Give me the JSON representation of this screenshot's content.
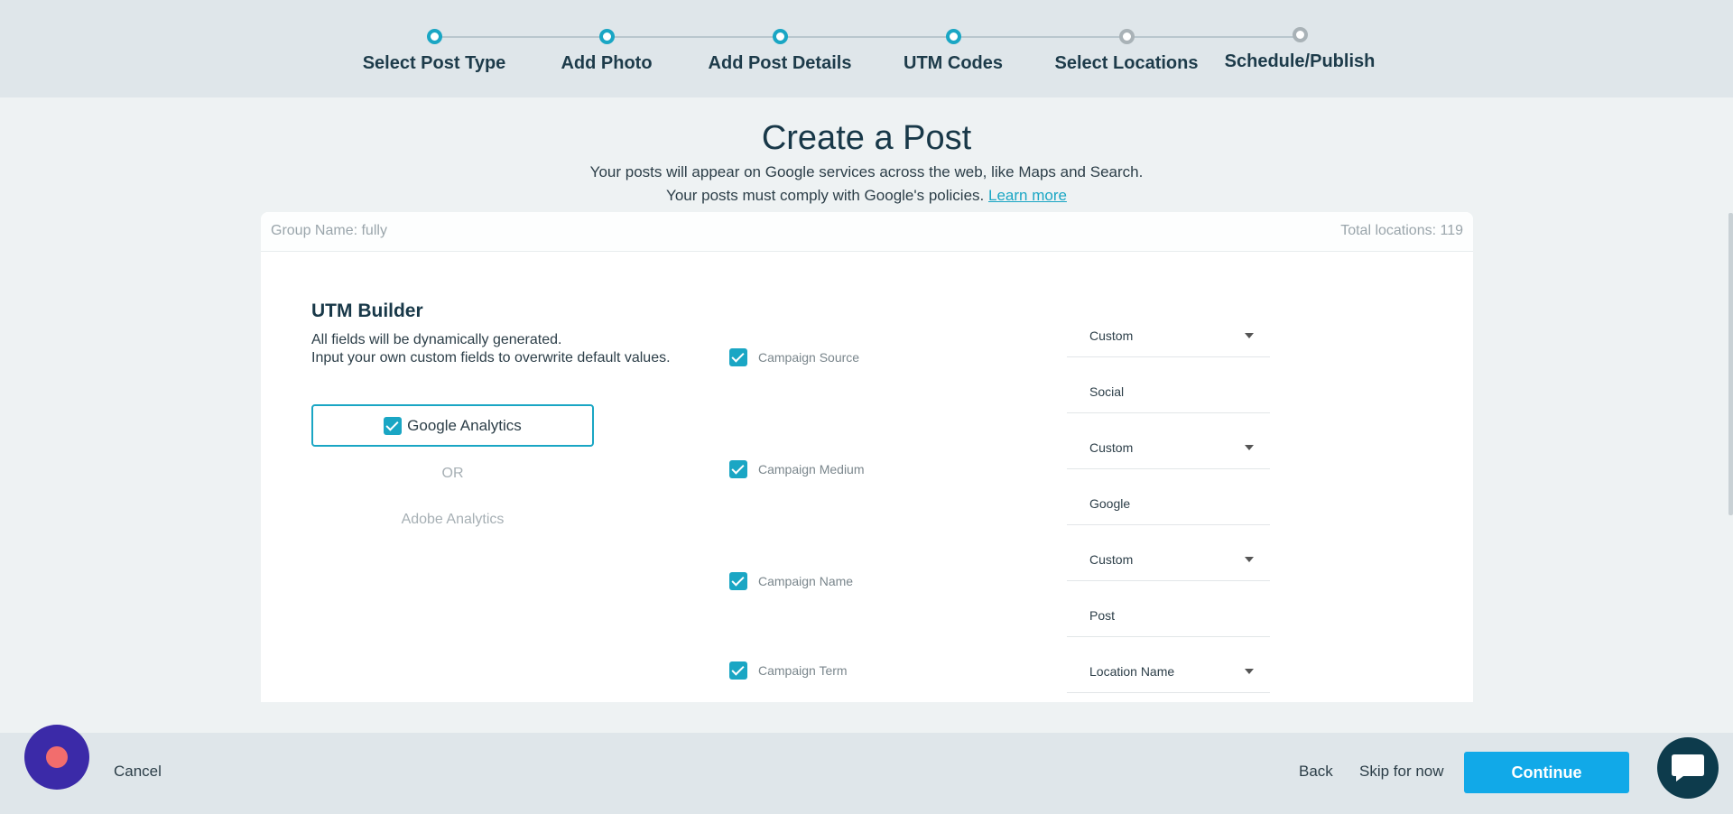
{
  "stepper": {
    "steps": [
      {
        "label": "Select Post Type",
        "state": "done"
      },
      {
        "label": "Add Photo",
        "state": "done"
      },
      {
        "label": "Add Post Details",
        "state": "done"
      },
      {
        "label": "UTM Codes",
        "state": "current"
      },
      {
        "label": "Select Locations",
        "state": "pending"
      },
      {
        "label": "Schedule/Publish",
        "state": "pending"
      }
    ]
  },
  "header": {
    "title": "Create a Post",
    "subtitle_line1": "Your posts will appear on Google services across the web, like Maps and Search.",
    "subtitle_line2": "Your posts must comply with Google's policies.",
    "learn_more": "Learn more"
  },
  "card": {
    "group_name": "Group Name: fully",
    "total_locations": "Total locations: 119"
  },
  "utm": {
    "title": "UTM Builder",
    "desc_line1": "All fields will be dynamically generated.",
    "desc_line2": "Input your own custom fields to overwrite default values.",
    "google_analytics": "Google Analytics",
    "or": "OR",
    "adobe_analytics": "Adobe Analytics"
  },
  "fields": {
    "source": {
      "label": "Campaign Source",
      "select": "Custom",
      "value": "Social"
    },
    "medium": {
      "label": "Campaign Medium",
      "select": "Custom",
      "value": "Google"
    },
    "name": {
      "label": "Campaign Name",
      "select": "Custom",
      "value": "Post"
    },
    "term": {
      "label": "Campaign Term",
      "select": "Location Name"
    }
  },
  "footer": {
    "cancel": "Cancel",
    "back": "Back",
    "skip": "Skip for now",
    "continue": "Continue"
  },
  "colors": {
    "accent": "#1aa6c4",
    "primary_button": "#11a9e8",
    "launcher": "#3b2aa8",
    "chat": "#0d3b4c"
  }
}
